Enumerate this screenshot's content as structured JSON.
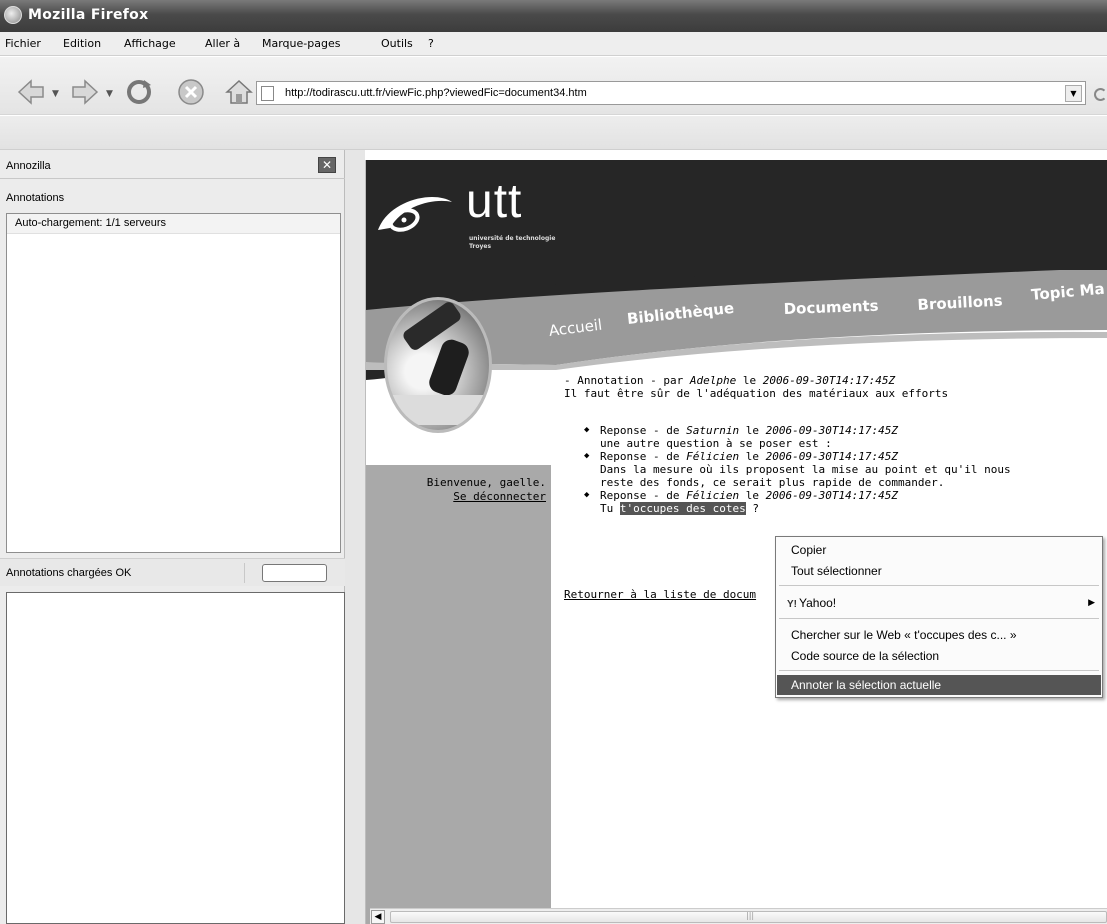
{
  "window": {
    "title": "Mozilla Firefox"
  },
  "menubar": {
    "items": [
      "Fichier",
      "Edition",
      "Affichage",
      "Aller à",
      "Marque-pages",
      "Outils",
      "?"
    ]
  },
  "navbar": {
    "url": "http://todirascu.utt.fr/viewFic.php?viewedFic=document34.htm"
  },
  "sidebar": {
    "title": "Annozilla",
    "annotations_label": "Annotations",
    "list_items": [
      "Auto-chargement: 1/1 serveurs"
    ],
    "status_text": "Annotations chargées OK"
  },
  "page": {
    "logo_word": "utt",
    "logo_subtitle_line1": "université de technologie",
    "logo_subtitle_line2": "Troyes",
    "nav": [
      "Accueil",
      "Bibliothèque",
      "Documents",
      "Brouillons",
      "Topic Ma"
    ],
    "welcome": "Bienvenue, gaelle.",
    "logout": "Se déconnecter",
    "annotation": {
      "prefix": "- Annotation - par",
      "author": "Adelphe",
      "le": "le",
      "date": "2006-09-30T14:17:45Z",
      "text": "Il faut être sûr de l'adéquation des matériaux aux efforts"
    },
    "replies": [
      {
        "prefix": "Reponse - de",
        "author": "Saturnin",
        "le": "le",
        "date": "2006-09-30T14:17:45Z",
        "text": "une autre question à se poser est :"
      },
      {
        "prefix": "Reponse - de",
        "author": "Félicien",
        "le": "le",
        "date": "2006-09-30T14:17:45Z",
        "text_line1": "Dans la mesure où ils proposent la mise au point et qu'il nous",
        "text_line2": "reste des fonds, ce serait plus rapide de commander."
      },
      {
        "prefix": "Reponse - de",
        "author": "Félicien",
        "le": "le",
        "date": "2006-09-30T14:17:45Z",
        "text_before": "Tu ",
        "text_selected": "t'occupes des cotes",
        "text_after": " ?"
      }
    ],
    "back_link": "Retourner à la liste de docum"
  },
  "context_menu": {
    "copy": "Copier",
    "select_all": "Tout sélectionner",
    "yahoo": "Yahoo!",
    "search_web": "Chercher sur le Web « t'occupes des c... »",
    "view_source": "Code source de la sélection",
    "annotate": "Annoter la sélection actuelle"
  },
  "colors": {
    "title_bar": "#4a4a4a",
    "header_dark": "#262626",
    "nav_band": "#9a9a9a",
    "selection": "#555555"
  }
}
